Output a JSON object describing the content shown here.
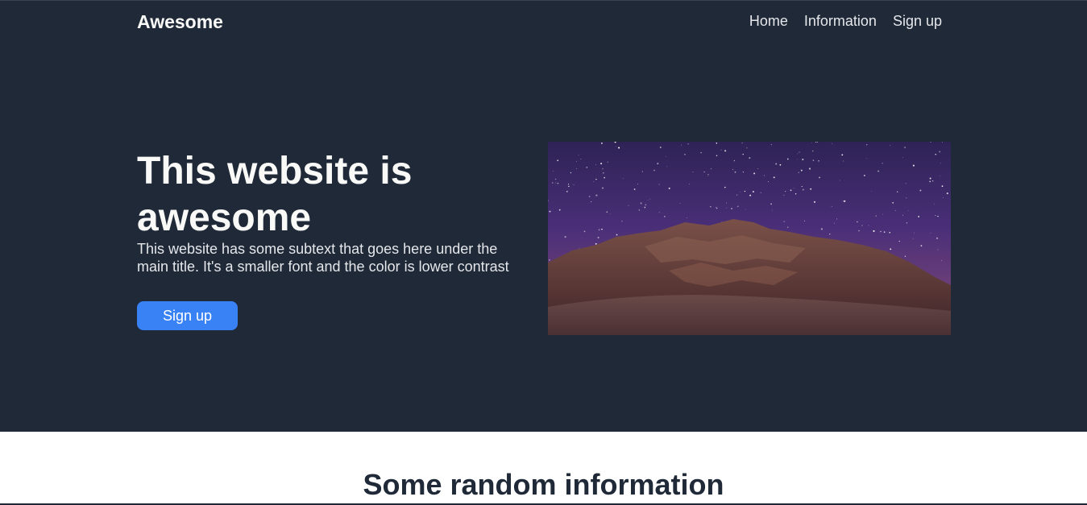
{
  "header": {
    "logo": "Awesome",
    "nav": [
      {
        "label": "Home"
      },
      {
        "label": "Information"
      },
      {
        "label": "Sign up"
      }
    ]
  },
  "hero": {
    "title": "This website is awesome",
    "subtext": "This website has some subtext that goes here under the main title. It's a smaller font and the color is lower contrast",
    "button_label": "Sign up",
    "image": "night-sky-mountain-image"
  },
  "info": {
    "title": "Some random information"
  },
  "colors": {
    "hero_bg": "#1f2937",
    "accent": "#3882f6",
    "light_text": "#f9faf8",
    "muted_text": "#e5e7eb"
  }
}
